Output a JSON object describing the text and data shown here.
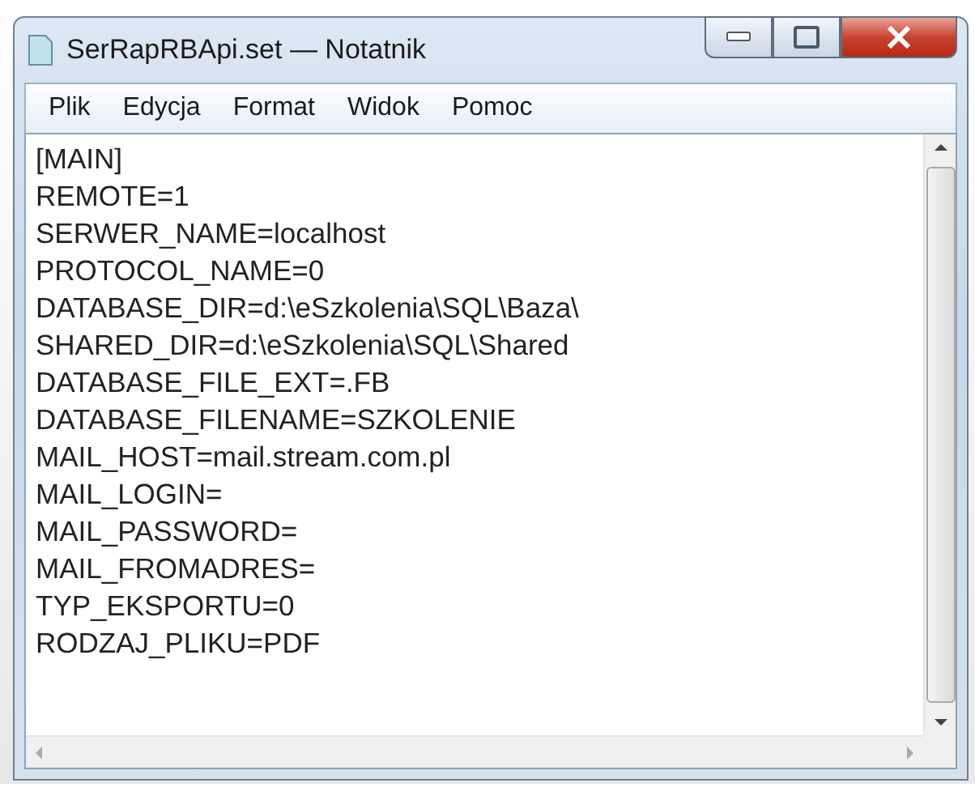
{
  "window": {
    "title": "SerRapRBApi.set — Notatnik"
  },
  "menu": [
    "Plik",
    "Edycja",
    "Format",
    "Widok",
    "Pomoc"
  ],
  "editor": {
    "lines": [
      "[MAIN]",
      "REMOTE=1",
      "SERWER_NAME=localhost",
      "PROTOCOL_NAME=0",
      "DATABASE_DIR=d:\\eSzkolenia\\SQL\\Baza\\",
      "SHARED_DIR=d:\\eSzkolenia\\SQL\\Shared",
      "DATABASE_FILE_EXT=.FB",
      "DATABASE_FILENAME=SZKOLENIE",
      "MAIL_HOST=mail.stream.com.pl",
      "MAIL_LOGIN=",
      "MAIL_PASSWORD=",
      "MAIL_FROMADRES=",
      "TYP_EKSPORTU=0",
      "RODZAJ_PLIKU=PDF"
    ]
  }
}
